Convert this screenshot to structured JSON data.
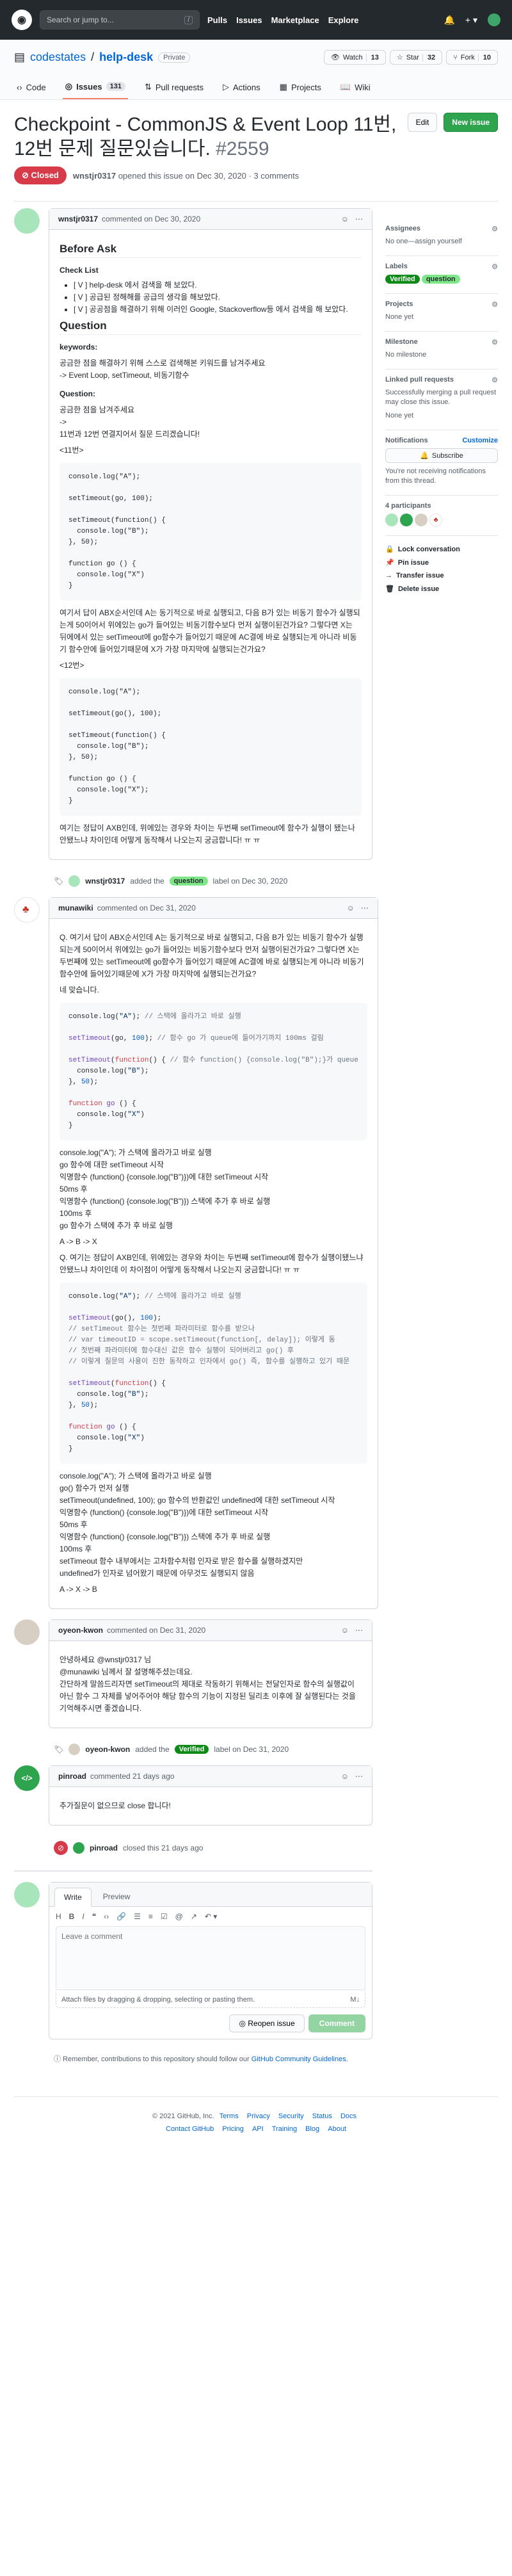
{
  "topbar": {
    "search_placeholder": "Search or jump to...",
    "search_key": "/",
    "nav": [
      "Pulls",
      "Issues",
      "Marketplace",
      "Explore"
    ]
  },
  "repo": {
    "owner": "codestates",
    "name": "help-desk",
    "visibility": "Private",
    "watch_label": "Watch",
    "watch_count": "13",
    "star_label": "Star",
    "star_count": "32",
    "fork_label": "Fork",
    "fork_count": "10"
  },
  "tabs": [
    {
      "label": "Code"
    },
    {
      "label": "Issues",
      "count": "131"
    },
    {
      "label": "Pull requests"
    },
    {
      "label": "Actions"
    },
    {
      "label": "Projects"
    },
    {
      "label": "Wiki"
    }
  ],
  "issue": {
    "title": "Checkpoint - CommonJS & Event Loop 11번, 12번 문제 질문있습니다.",
    "number": "#2559",
    "edit_label": "Edit",
    "new_label": "New issue",
    "status": "Closed",
    "meta_author": "wnstjr0317",
    "meta_text": "opened this issue on Dec 30, 2020 · 3 comments"
  },
  "comments": [
    {
      "author": "wnstjr0317",
      "when": "commented on Dec 30, 2020",
      "avatar_color": "#a9e5bb",
      "h_before": "Before Ask",
      "h_checklist": "Check List",
      "checklist": [
        "[ V ] help-desk 에서 검색을 해 보았다.",
        "[ V ] 공급된 정해해를 공급의 생각을 해보았다.",
        "[ V ] 공공점을 해결하기 위해 이러인 Google, Stackoverflow등 에서 검색을 해 보았다."
      ],
      "h_question": "Question",
      "h_keywords": "keywords:",
      "keywords_1": "공금한 점을 해결하기 위해 스스로 검색해본 키워드를 남겨주세요",
      "keywords_2": "-> Event Loop, setTimeout, 비동기함수",
      "h_question2": "Question:",
      "question_1": "공금한 점을 남겨주세요",
      "question_2": "->",
      "question_3": "11번과 12번 연결지어서 질문 드리겠습니다!",
      "tag11": "<11번>",
      "code11": "console.log(\"A\");\n\nsetTimeout(go, 100);\n\nsetTimeout(function() {\n  console.log(\"B\");\n}, 50);\n\nfunction go () {\n  console.log(\"X\")\n}",
      "para_1": "여기서 답이 ABX순서인데 A는 동기적으로 바로 실행되고, 다음 B가 있는 비동기 함수가 실행되는게 50이어서 위에있는 go가 들어있는 비동기함수보다 먼저 실행이된건가요? 그렇다면 X는 뒤에에서 있는 setTimeout에 go함수가 들어있기 때문에 AC결에 바로 실행되는게 아니라 비동기 함수안에 들어있기때문에 X가 가장 마지막에 실행되는건가요?",
      "tag12": "<12번>",
      "code12": "console.log(\"A\");\n\nsetTimeout(go(), 100);\n\nsetTimeout(function() {\n  console.log(\"B\");\n}, 50);\n\nfunction go () {\n  console.log(\"X\");\n}",
      "para_2": "여기는 정답이 AXB인데, 위에있는 경우와 차이는 두번째 setTimeout에 함수가 실행이 됐는나 안됐느냐 차이인데 어떻게 동작해서 나오는지 궁금합니다! ㅠ ㅠ"
    },
    {
      "author": "munawiki",
      "when": "commented on Dec 31, 2020",
      "avatar_color": "#c0392b",
      "quote": "Q. 여기서 답이 ABX순서인데 A는 동기적으로 바로 실행되고, 다음 B가 있는 비동기 함수가 실행되는게 50이어서 위에있는 go가 들어있는 비동기함수보다 먼저 실행이된건가요? 그렇다면 X는 두번째에 있는 setTimeout에 go함수가 들어있기 때문에 AC결에 바로 실행되는게 아니라 비동기 함수안에 들어있기때문에 X가 가장 마지막에 실행되는건가요?",
      "answer_intro": "네 맞습니다.",
      "lines_1": [
        "console.log(\"A\"); 가 스택에 올라가고 바로 실행",
        "go 함수에 대한 setTimeout 시작",
        "익명함수 (function() {console.log(\"B\")})에 대한 setTimeout 시작",
        "50ms 후",
        "익명함수 (function() {console.log(\"B\")}) 스택에 추가 후 바로 실행",
        "100ms 후",
        "go 함수가 스택에 추가 후 바로 실행"
      ],
      "result_1": "A -> B -> X",
      "quote_2": "Q. 여기는 정답이 AXB인데, 위에있는 경우와 차이는 두번째 setTimeout에 함수가 실행이됐느냐 안됐느냐 차이인데 이 차이점이 어떻게 동작해서 나오는지 궁금합니다! ㅠ ㅠ",
      "lines_2": [
        "console.log(\"A\"); 가 스택에 올라가고 바로 실행",
        "go() 함수가 먼저 실행",
        "setTimeout(undefined, 100); go 함수의 반환값인 undefined에 대한 setTimeout 시작",
        "익명함수 (function() {console.log(\"B\")})에 대한 setTimeout 시작",
        "50ms 후",
        "익명함수 (function() {console.log(\"B\")}) 스택에 추가 후 바로 실행",
        "100ms 후",
        "setTimeout 함수 내부에서는 고차함수처럼 인자로 받은 함수를 실행하겠지만",
        "undefined가 인자로 넘어왔기 때문에 아무것도 실행되지 않음"
      ],
      "result_2": "A -> X -> B"
    },
    {
      "author": "oyeon-kwon",
      "when": "commented on Dec 31, 2020",
      "avatar_color": "#d8cfc4",
      "line_1": "안녕하세요 @wnstjr0317 님",
      "line_2": "@munawiki 님께서 잘 설명해주셨는데요.",
      "line_3": "간단하게 말씀드리자면 setTimeout의 제대로 작동하기 위해서는 전달인자로 함수의 실행값이 아닌 함수 그 자체를 넣어주어야 해당 함수의 기능이 지정된 딜리초 이후에 잘 실행된다는 것을 기억해주시면 좋겠습니다."
    },
    {
      "author": "pinroad",
      "when": "commented 21 days ago",
      "avatar_color": "#2ea44f",
      "text": "추가질문이 없으므로 close 합니다!"
    }
  ],
  "events": {
    "label_1_author": "wnstjr0317",
    "label_1_pre": "added the",
    "label_1_name": "question",
    "label_1_post": "label on Dec 30, 2020",
    "label_2_author": "oyeon-kwon",
    "label_2_pre": "added the",
    "label_2_name": "Verified",
    "label_2_post": "label on Dec 31, 2020",
    "closed_author": "pinroad",
    "closed_text": "closed this 21 days ago"
  },
  "sidebar": {
    "assignees_title": "Assignees",
    "assignees_value": "No one—assign yourself",
    "labels_title": "Labels",
    "label_verified": "Verified",
    "label_question": "question",
    "projects_title": "Projects",
    "projects_value": "None yet",
    "milestone_title": "Milestone",
    "milestone_value": "No milestone",
    "linked_title": "Linked pull requests",
    "linked_value": "Successfully merging a pull request may close this issue.",
    "linked_none": "None yet",
    "notif_title": "Notifications",
    "notif_custom": "Customize",
    "subscribe_label": "Subscribe",
    "notif_text": "You're not receiving notifications from this thread.",
    "participants_title": "4 participants",
    "lock_label": "Lock conversation",
    "pin_label": "Pin issue",
    "transfer_label": "Transfer issue",
    "delete_label": "Delete issue"
  },
  "composer": {
    "tab_write": "Write",
    "tab_preview": "Preview",
    "placeholder": "Leave a comment",
    "attach_text": "Attach files by dragging & dropping, selecting or pasting them.",
    "reopen_label": "Reopen issue",
    "comment_label": "Comment",
    "note_pre": "Remember, contributions to this repository should follow our",
    "note_link": "GitHub Community Guidelines",
    "note_post": "."
  },
  "footer": {
    "copyright": "© 2021 GitHub, Inc.",
    "links_1": [
      "Terms",
      "Privacy",
      "Security",
      "Status",
      "Docs"
    ],
    "links_2": [
      "Contact GitHub",
      "Pricing",
      "API",
      "Training",
      "Blog",
      "About"
    ]
  },
  "colors": {
    "closed": "#d73a49",
    "label_verified": "#0e8a16",
    "label_question": "#7ee787",
    "accent": "#0366d6"
  }
}
